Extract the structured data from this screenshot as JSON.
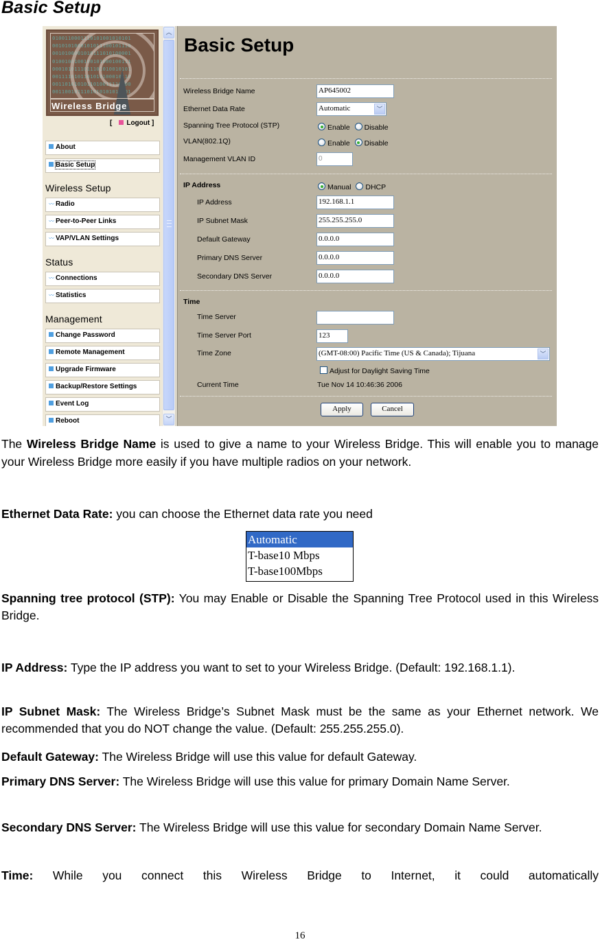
{
  "document": {
    "heading": "Basic Setup",
    "page_number": "16"
  },
  "screenshot": {
    "sidebar": {
      "logo_text": "Wireless Bridge",
      "logout_open": "[",
      "logout_label": "Logout ]",
      "top_items": [
        {
          "label": "About"
        },
        {
          "label": "Basic Setup"
        }
      ],
      "sections": [
        {
          "title": "Wireless Setup",
          "items": [
            {
              "label": "Radio"
            },
            {
              "label": "Peer-to-Peer Links"
            },
            {
              "label": "VAP/VLAN Settings"
            }
          ]
        },
        {
          "title": "Status",
          "items": [
            {
              "label": "Connections"
            },
            {
              "label": "Statistics"
            }
          ]
        },
        {
          "title": "Management",
          "items": [
            {
              "label": "Change Password"
            },
            {
              "label": "Remote Management"
            },
            {
              "label": "Upgrade Firmware"
            },
            {
              "label": "Backup/Restore Settings"
            },
            {
              "label": "Event Log"
            },
            {
              "label": "Reboot"
            }
          ]
        }
      ]
    },
    "main": {
      "title": "Basic Setup",
      "wireless_bridge_name": {
        "label": "Wireless Bridge Name",
        "value": "AP645002"
      },
      "ethernet_data_rate": {
        "label": "Ethernet Data Rate",
        "value": "Automatic"
      },
      "stp": {
        "label": "Spanning Tree Protocol (STP)",
        "options": [
          "Enable",
          "Disable"
        ],
        "selected": "Enable"
      },
      "vlan": {
        "label": "VLAN(802.1Q)",
        "options": [
          "Enable",
          "Disable"
        ],
        "selected": "Disable"
      },
      "mgmt_vlan_id": {
        "label": "Management VLAN ID",
        "value": "0"
      },
      "ip_section": {
        "label": "IP Address",
        "options": [
          "Manual",
          "DHCP"
        ],
        "selected": "Manual"
      },
      "ip_address": {
        "label": "IP Address",
        "value": "192.168.1.1"
      },
      "subnet_mask": {
        "label": "IP Subnet Mask",
        "value": "255.255.255.0"
      },
      "default_gateway": {
        "label": "Default Gateway",
        "value": "0.0.0.0"
      },
      "primary_dns": {
        "label": "Primary DNS Server",
        "value": "0.0.0.0"
      },
      "secondary_dns": {
        "label": "Secondary DNS Server",
        "value": "0.0.0.0"
      },
      "time_section": {
        "label": "Time"
      },
      "time_server": {
        "label": "Time Server",
        "value": ""
      },
      "time_server_port": {
        "label": "Time Server Port",
        "value": "123"
      },
      "time_zone": {
        "label": "Time Zone",
        "value": "(GMT-08:00) Pacific Time (US & Canada); Tijuana"
      },
      "dst": {
        "label": "Adjust for Daylight Saving Time",
        "checked": false
      },
      "current_time": {
        "label": "Current Time",
        "value": "Tue Nov 14 10:46:36 2006"
      },
      "apply_label": "Apply",
      "cancel_label": "Cancel"
    }
  },
  "body": {
    "p1": {
      "pre": "The ",
      "bold": "Wireless Bridge Name",
      "text": " is used to give a name to your Wireless Bridge. This will enable you to manage your Wireless Bridge more easily if you have multiple radios on your network."
    },
    "p2": {
      "bold": "Ethernet Data Rate:",
      "text": " you can choose the Ethernet data rate you need"
    },
    "rate_options": [
      {
        "label": "Automatic",
        "selected": true
      },
      {
        "label": "T-base10 Mbps",
        "selected": false
      },
      {
        "label": "T-base100Mbps",
        "selected": false
      }
    ],
    "p3": {
      "bold": "Spanning tree protocol (STP):",
      "text": " You may Enable or Disable the Spanning Tree Protocol used in this Wireless Bridge."
    },
    "p4": {
      "bold": "IP Address:",
      "text": " Type the IP address you want to set to your Wireless Bridge. (Default: 192.168.1.1)."
    },
    "p5": {
      "bold": "IP Subnet Mask:",
      "text": " The Wireless Bridge’s Subnet Mask must be the same as your Ethernet network. We recommended that you do NOT change the value. (Default: 255.255.255.0)."
    },
    "p6": {
      "bold": "Default Gateway:",
      "text": " The Wireless Bridge will use this value for default Gateway."
    },
    "p7": {
      "bold": "Primary DNS Server:",
      "text": " The Wireless Bridge will use this value for primary Domain Name Server."
    },
    "p8": {
      "bold": "Secondary DNS Server:",
      "text": " The Wireless Bridge will use this value for secondary Domain Name Server."
    },
    "p9": {
      "bold": "Time:",
      "text": " While you connect this Wireless Bridge to Internet, it could automatically"
    }
  }
}
